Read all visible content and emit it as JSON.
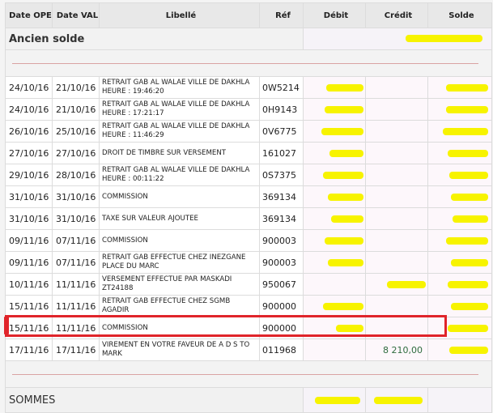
{
  "headers": {
    "date_ope": "Date OPE",
    "date_val": "Date VAL",
    "libelle": "Libellé",
    "ref": "Réf",
    "debit": "Débit",
    "credit": "Crédit",
    "solde": "Solde"
  },
  "ancien_solde": {
    "label": "Ancien solde"
  },
  "rows": [
    {
      "ope": "24/10/16",
      "val": "21/10/16",
      "libelle": "RETRAIT GAB AL WALAE VILLE DE DAKHLA HEURE : 19:46:20",
      "ref": "0W5214",
      "credit": ""
    },
    {
      "ope": "24/10/16",
      "val": "21/10/16",
      "libelle": "RETRAIT GAB AL WALAE VILLE DE DAKHLA HEURE : 17:21:17",
      "ref": "0H9143",
      "credit": ""
    },
    {
      "ope": "26/10/16",
      "val": "25/10/16",
      "libelle": "RETRAIT GAB AL WALAE VILLE DE DAKHLA HEURE : 11:46:29",
      "ref": "0V6775",
      "credit": ""
    },
    {
      "ope": "27/10/16",
      "val": "27/10/16",
      "libelle": "DROIT DE TIMBRE SUR VERSEMENT",
      "ref": "161027",
      "credit": ""
    },
    {
      "ope": "29/10/16",
      "val": "28/10/16",
      "libelle": "RETRAIT GAB AL WALAE VILLE DE DAKHLA HEURE : 00:11:22",
      "ref": "0S7375",
      "credit": ""
    },
    {
      "ope": "31/10/16",
      "val": "31/10/16",
      "libelle": "COMMISSION",
      "ref": "369134",
      "credit": ""
    },
    {
      "ope": "31/10/16",
      "val": "31/10/16",
      "libelle": "TAXE SUR VALEUR AJOUTEE",
      "ref": "369134",
      "credit": ""
    },
    {
      "ope": "09/11/16",
      "val": "07/11/16",
      "libelle": "COMMISSION",
      "ref": "900003",
      "credit": ""
    },
    {
      "ope": "09/11/16",
      "val": "07/11/16",
      "libelle": "RETRAIT GAB EFFECTUE CHEZ INEZGANE PLACE DU MARC",
      "ref": "900003",
      "credit": ""
    },
    {
      "ope": "10/11/16",
      "val": "11/11/16",
      "libelle": "VERSEMENT EFFECTUE PAR MASKADI ZT24188",
      "ref": "950067",
      "credit": ""
    },
    {
      "ope": "15/11/16",
      "val": "11/11/16",
      "libelle": "RETRAIT GAB EFFECTUE CHEZ SGMB AGADIR",
      "ref": "900000",
      "credit": ""
    },
    {
      "ope": "15/11/16",
      "val": "11/11/16",
      "libelle": "COMMISSION",
      "ref": "900000",
      "credit": ""
    },
    {
      "ope": "17/11/16",
      "val": "17/11/16",
      "libelle": "VIREMENT EN VOTRE FAVEUR DE A D S TO MARK",
      "ref": "011968",
      "credit": "8 210,00"
    }
  ],
  "sommes": {
    "label": "SOMMES"
  },
  "colors": {
    "highlight_box": "#e0242a",
    "redaction": "#f7f300",
    "credit_text": "#2e6b3e"
  }
}
